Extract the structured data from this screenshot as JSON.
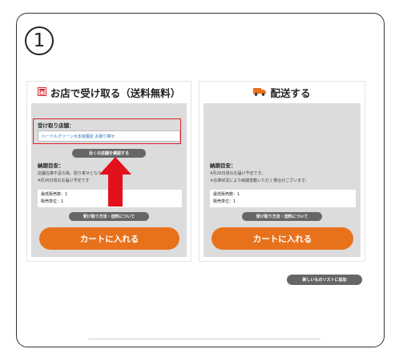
{
  "step": {
    "number": "1"
  },
  "left_card": {
    "icon": "store-icon",
    "title": "お店で受け取る（送料無料）",
    "store_label": "受け取り店舗：",
    "store_value": "ハードルグリーン大本宮園店 お取り寄せ",
    "nearby_button": "近くの店舗を確認する",
    "delivery_label": "納期目安：",
    "delivery_line1": "店舗在庫不足の為、取り寄せとなります",
    "delivery_line2": "4月26日頃のお届け予定です",
    "min_qty": "最低販売数：1",
    "unit": "販売単位：1",
    "method_button": "受け取り方法・送料について",
    "cart_button": "カートに入れる"
  },
  "right_card": {
    "icon": "truck-icon",
    "title": "配送する",
    "delivery_label": "納期目安：",
    "delivery_line1": "4月26日頃のお届け予定です。",
    "delivery_line2": "※在庫状況により納期変動いただく場合がございます。",
    "min_qty": "最低販売数：1",
    "unit": "販売単位：1",
    "method_button": "受け取り方法・送料について",
    "cart_button": "カートに入れる"
  },
  "wishlist_button": "新しいものリストに追加",
  "colors": {
    "accent": "#e8721c",
    "highlight": "#d9232e",
    "panel": "#dcdcdc",
    "pill": "#666666"
  }
}
